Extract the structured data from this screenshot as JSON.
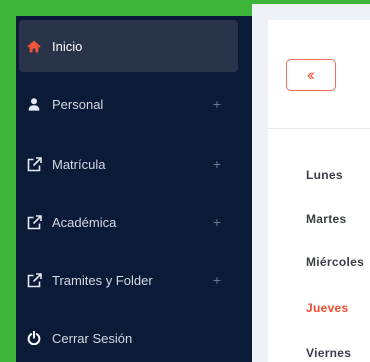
{
  "sidebar": {
    "items": [
      {
        "label": "Inicio",
        "icon": "home-icon",
        "active": true,
        "expandable": false
      },
      {
        "label": "Personal",
        "icon": "user-icon",
        "active": false,
        "expandable": true
      },
      {
        "label": "Matrícula",
        "icon": "external-link-icon",
        "active": false,
        "expandable": true
      },
      {
        "label": "Académica",
        "icon": "external-link-icon",
        "active": false,
        "expandable": true
      },
      {
        "label": "Tramites y Folder",
        "icon": "external-link-icon",
        "active": false,
        "expandable": true
      },
      {
        "label": "Cerrar Sesión",
        "icon": "power-icon",
        "active": false,
        "expandable": false
      }
    ],
    "plus": "+"
  },
  "main": {
    "back_label": "«",
    "days": [
      "Lunes",
      "Martes",
      "Miércoles",
      "Jueves",
      "Viernes"
    ],
    "active_day": "Jueves"
  },
  "colors": {
    "sidebar_bg": "#0b1a36",
    "active_item_bg": "#293349",
    "home_icon": "#f0553b",
    "accent": "#ef4b2e",
    "outer_bg": "#3cb43a"
  }
}
